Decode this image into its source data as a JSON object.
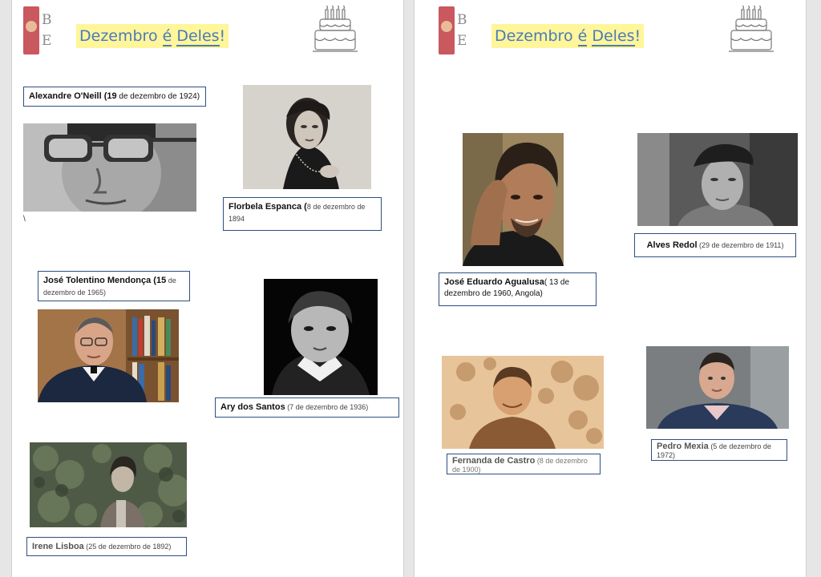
{
  "header": {
    "logo_letters": [
      "B",
      "E"
    ],
    "title_part1": "Dezembro ",
    "title_part2": "é",
    "title_part3": " ",
    "title_part4": "Deles",
    "title_part5": "!"
  },
  "left_page": {
    "oneill": {
      "name": "Alexandre O'Neill (",
      "day": "19",
      "date": " de dezembro de 1924)"
    },
    "florbela": {
      "name": "Florbela Espanca (",
      "date": "8 de dezembro de 1894"
    },
    "backslash": "\\",
    "tolentino": {
      "name": "José Tolentino Mendonça (",
      "day": "15",
      "date": " de dezembro de 1965)"
    },
    "ary": {
      "name": "Ary dos Santos",
      "date": " (7 de dezembro de 1936)"
    },
    "irene": {
      "name": "Irene Lisboa",
      "date": " (25 de dezembro de 1892)"
    }
  },
  "right_page": {
    "agualusa": {
      "name": "José Eduardo Agualusa",
      "date": "( 13 de dezembro de 1960, Angola)"
    },
    "redol": {
      "name": "Alves Redol",
      "date": " (29 de dezembro de 1911)"
    },
    "fernanda": {
      "name": "Fernanda de Castro",
      "date": " (8 de dezembro de 1900)"
    },
    "mexia": {
      "name": "Pedro Mexia",
      "date": " (5 de dezembro de 1972)"
    }
  }
}
